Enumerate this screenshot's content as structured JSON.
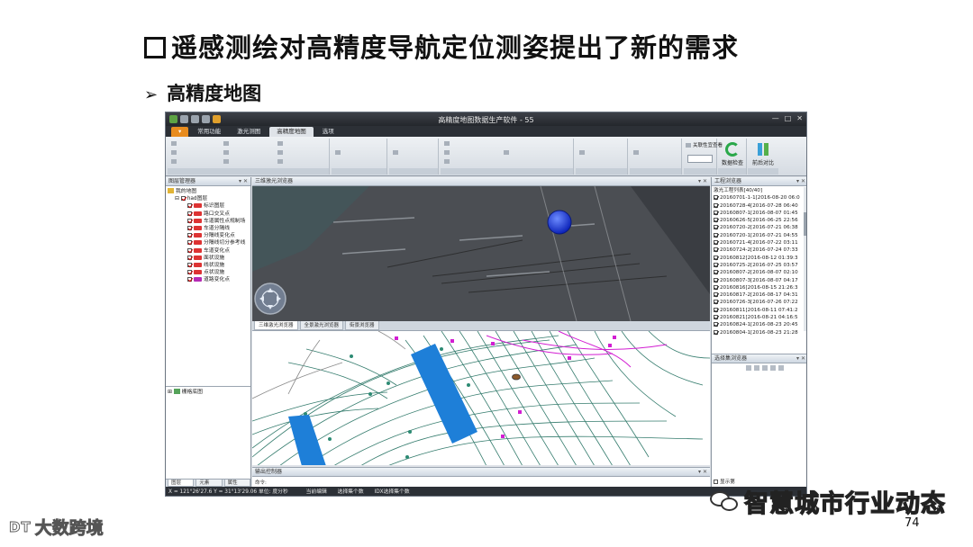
{
  "slide": {
    "title": "遥感测绘对高精度导航定位测姿提出了新的需求",
    "subtitle": "高精度地图",
    "page_number": "74",
    "watermark_right": "智慧城市行业动态",
    "watermark_left_logo": "DT",
    "watermark_left": "大数跨境"
  },
  "app": {
    "window_title": "高精度地图数据生产软件 - 55",
    "menu_tabs": [
      "常用功能",
      "激光测图",
      "高精度地图",
      "选项"
    ],
    "active_tab": "高精度地图",
    "ribbon": {
      "attr_value_label": "关联性宜查看",
      "check_button": "数据检查",
      "compare_button": "前后对比"
    },
    "layer_panel": {
      "title": "图层管理器",
      "root": "我的地图",
      "group": "had图层",
      "layers": [
        "标识图层",
        "路口交叉点",
        "车道属性点规制场",
        "车道分隔线",
        "分隔线变化点",
        "分隔线切分参考线",
        "车道变化点",
        "面状设施",
        "线状设施",
        "点状设施",
        "道路变化点"
      ],
      "lower_item": "栅格底图",
      "tabs": [
        "图层管...",
        "元素管...",
        "属性编..."
      ]
    },
    "view3d_title": "三维激光浏览器",
    "view_tabs": [
      "三维激光浏览器",
      "全景激光浏览器",
      "街景浏览器"
    ],
    "output_panel": {
      "title": "输出控制器",
      "command": "命令:"
    },
    "project_panel": {
      "title": "工程浏览器",
      "list_header": "激光工程列表[40/40]",
      "items": [
        "20160701-1-1[2016-08-20 06:0",
        "20160728-4[2016-07-28 06:40",
        "20160807-1[2016-08-07 01:45",
        "20160626-5[2016-06-25 22:56",
        "20160720-2[2016-07-21 06:38",
        "20160720-1[2016-07-21 04:55",
        "20160721-4[2016-07-22 03:11",
        "20160724-2[2016-07-24 07:33",
        "20160812[2016-08-12 01:39:3",
        "20160725-2[2016-07-25 03:57",
        "20160807-2[2016-08-07 02:10",
        "20160807-3[2016-08-07 04:17",
        "20160816[2016-08-15 21:26:3",
        "20160817-2[2016-08-17 04:31",
        "20160726-3[2016-07-26 07:22",
        "20160811[2016-08-11 07:41:2",
        "20160821[2016-08-21 04:16:5",
        "20160824-1[2016-08-23 20:45",
        "20160804-1[2016-08-23 21:28"
      ]
    },
    "selection_panel": {
      "title": "选择集浏览器",
      "show_label": "显示第"
    },
    "status": {
      "coords": "X = 121°26'27.6  Y = 31°13'29.06  单位: 度分秒",
      "mode": "当前编辑",
      "sel": "选择集个数",
      "idx": "IDX选择集个数"
    }
  },
  "colors": {
    "file_tab": "#e88c1e",
    "crosswalk_blue": "#1e7fd8",
    "marker_magenta": "#d21ed2",
    "road_green": "#1f6e5e",
    "blue_sphere": "#1f3fe0",
    "status_dark": "#2c3036"
  }
}
